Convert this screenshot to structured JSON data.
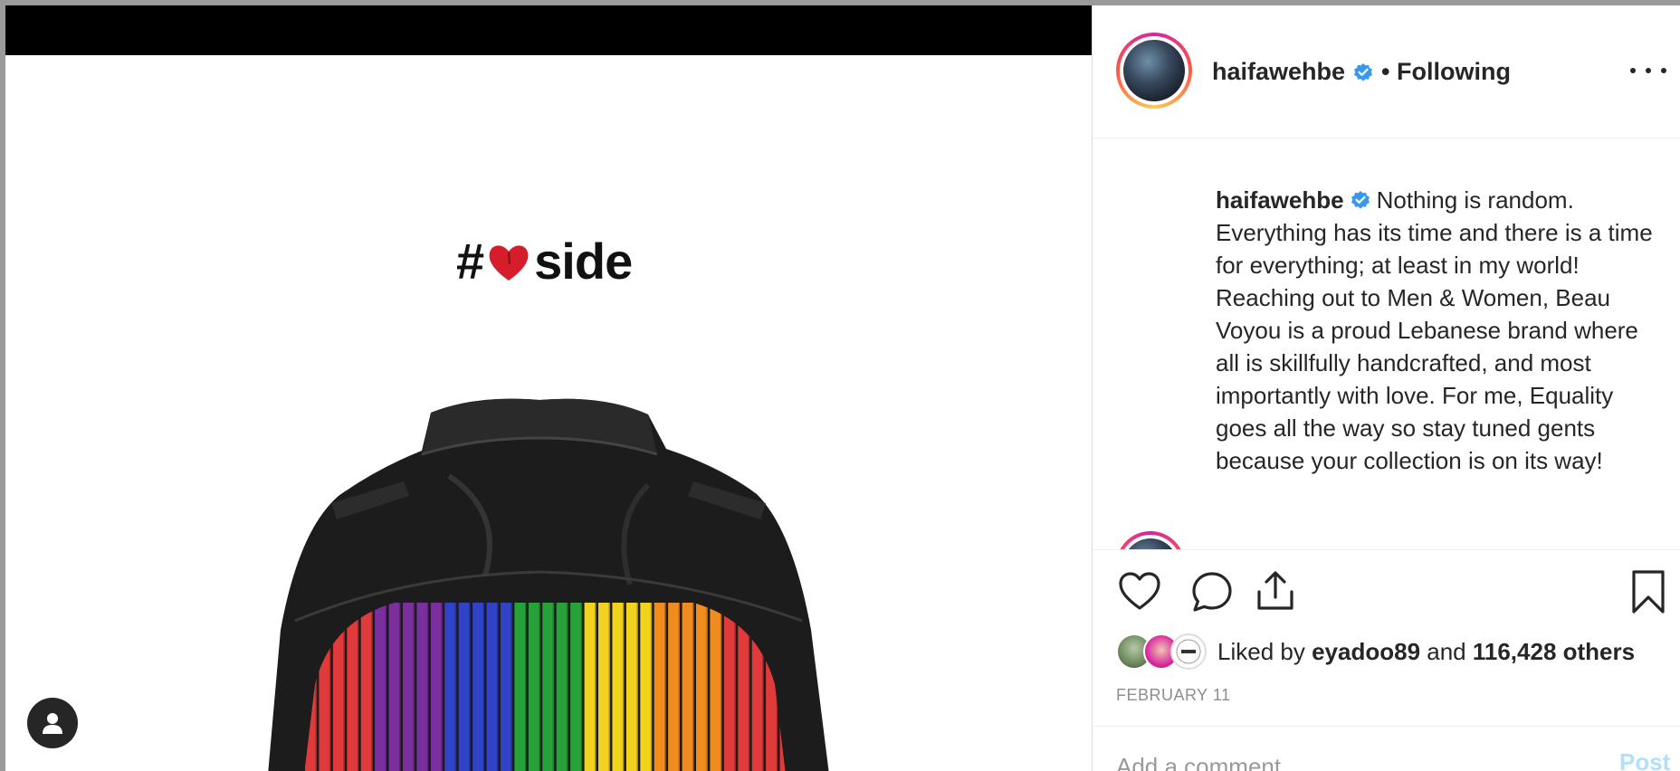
{
  "media": {
    "hashtag_prefix": "#",
    "hashtag_suffix": "side",
    "heart_color": "#d61d2c",
    "stripe_colors": [
      "#e03a3a",
      "#7a2f9c",
      "#2f42c8",
      "#27a23a",
      "#f1d21f",
      "#f08c1e",
      "#e03a3a"
    ],
    "user_tag_icon": "user-icon"
  },
  "post": {
    "username": "haifawehbe",
    "verified_color": "#3897f0",
    "follow_state": "• Following",
    "more_icon": "more-options-icon",
    "caption": "Nothing is random. Everything has its time and there is a time for everything; at least in my world!\nReaching out to Men & Women, Beau Voyou is a proud Lebanese brand where all is skillfully handcrafted, and most importantly with love. For me, Equality goes all the way so stay tuned gents because your collection is on its way!",
    "actions": {
      "like_icon": "heart-icon",
      "comment_icon": "comment-icon",
      "share_icon": "share-icon",
      "save_icon": "bookmark-icon"
    },
    "likes": {
      "prefix": "Liked by ",
      "first_liker": "eyadoo89",
      "middle": " and ",
      "others": "116,428 others"
    },
    "date": "FEBRUARY 11",
    "comment_placeholder": "Add a comment…",
    "post_label": "Post"
  }
}
